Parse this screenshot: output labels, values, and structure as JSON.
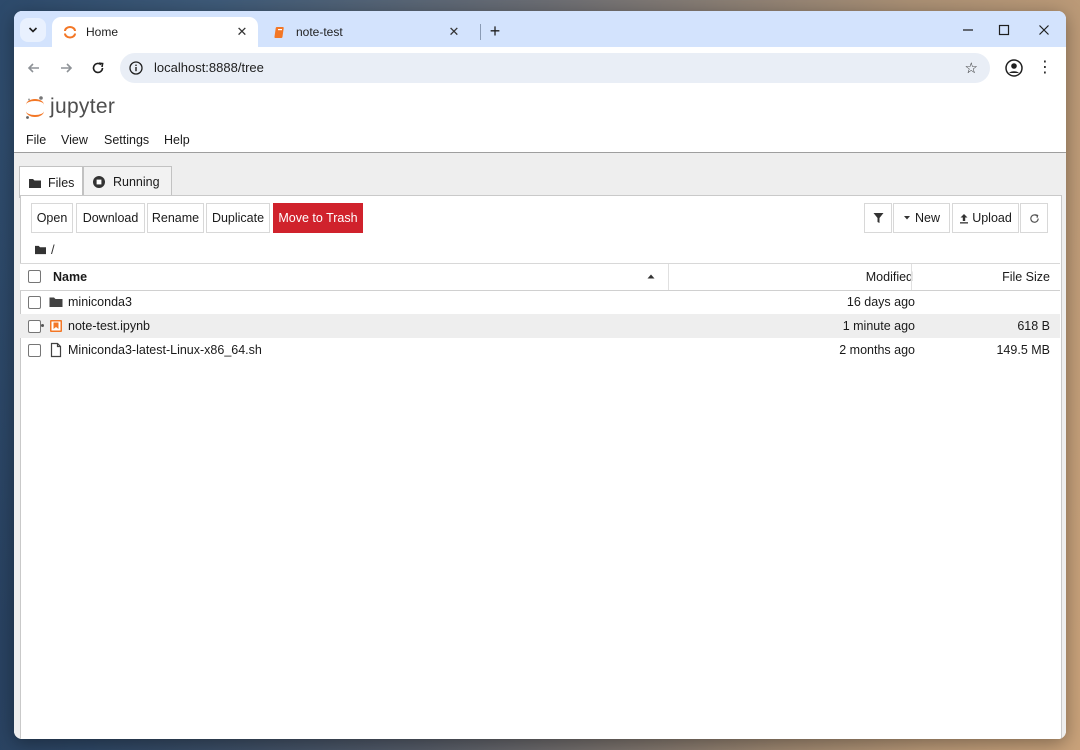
{
  "browser": {
    "tabs": [
      {
        "title": "Home",
        "active": true
      },
      {
        "title": "note-test",
        "active": false
      }
    ],
    "url": "localhost:8888/tree"
  },
  "jupyter": {
    "wordmark": "jupyter",
    "menu": [
      "File",
      "View",
      "Settings",
      "Help"
    ],
    "side_tabs": [
      {
        "label": "Files",
        "icon": "folder-icon"
      },
      {
        "label": "Running",
        "icon": "stop-circle-icon"
      }
    ],
    "toolbar": {
      "open": "Open",
      "download": "Download",
      "rename": "Rename",
      "duplicate": "Duplicate",
      "trash": "Move to Trash",
      "new": "New",
      "upload": "Upload"
    },
    "breadcrumb": "/",
    "columns": {
      "name": "Name",
      "modified": "Modified",
      "size": "File Size"
    },
    "files": [
      {
        "name": "miniconda3",
        "type": "directory",
        "modified": "16 days ago",
        "size": ""
      },
      {
        "name": "note-test.ipynb",
        "type": "notebook",
        "modified": "1 minute ago",
        "size": "618 B",
        "selected": true,
        "running": true
      },
      {
        "name": "Miniconda3-latest-Linux-x86_64.sh",
        "type": "file",
        "modified": "2 months ago",
        "size": "149.5 MB"
      }
    ]
  },
  "colors": {
    "danger": "#d0222c",
    "jupyter_orange": "#f37726",
    "tabstrip": "#d3e3fd"
  }
}
